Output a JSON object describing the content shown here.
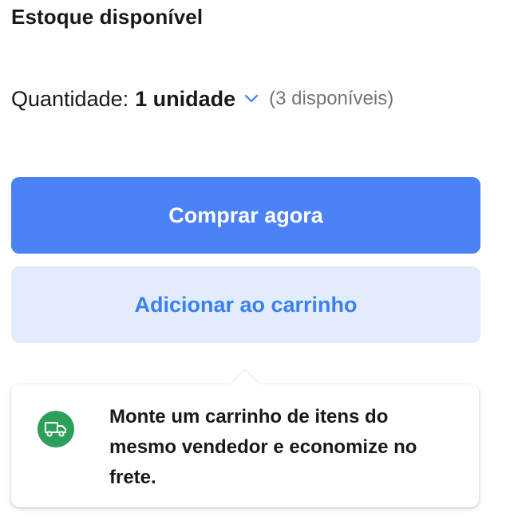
{
  "stock": {
    "title": "Estoque disponível"
  },
  "quantity": {
    "label": "Quantidade:",
    "value": "1 unidade",
    "available": "(3 disponíveis)"
  },
  "buttons": {
    "buy_now": "Comprar agora",
    "add_to_cart": "Adicionar ao carrinho"
  },
  "tooltip": {
    "message": "Monte um carrinho de itens do mesmo vendedor e economize no frete.",
    "icon": "truck-icon"
  },
  "colors": {
    "primary": "#4b82f7",
    "secondary_bg": "#e3ecfb",
    "secondary_text": "#3a80f4",
    "success": "#2ca05a"
  }
}
